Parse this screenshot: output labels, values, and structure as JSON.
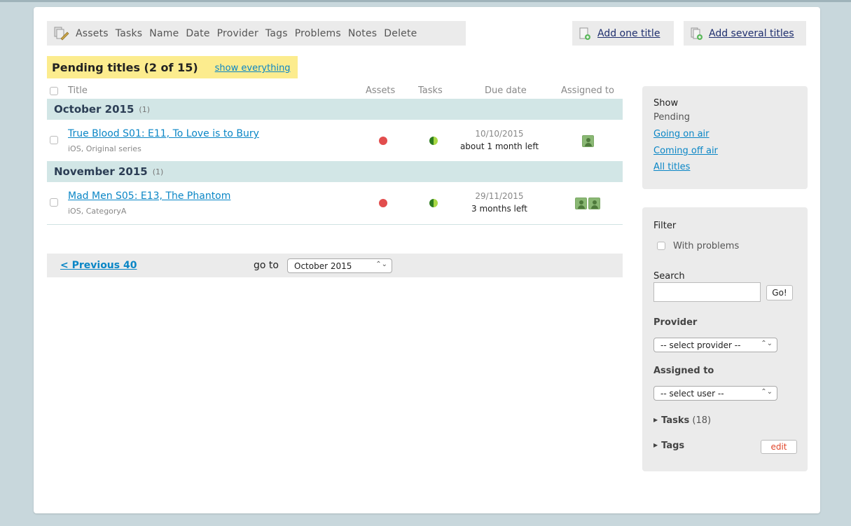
{
  "toolbar": {
    "items": [
      "Assets",
      "Tasks",
      "Name",
      "Date",
      "Provider",
      "Tags",
      "Problems",
      "Notes",
      "Delete"
    ],
    "add_one": "Add one title",
    "add_several": "Add several titles"
  },
  "heading": {
    "title": "Pending titles (2 of 15)",
    "show_everything": "show everything"
  },
  "table": {
    "columns": {
      "title": "Title",
      "assets": "Assets",
      "tasks": "Tasks",
      "due": "Due date",
      "assigned": "Assigned to"
    },
    "groups": [
      {
        "month": "October 2015",
        "count": "(1)",
        "rows": [
          {
            "title": "True Blood S01: E11, To Love is to Bury",
            "sub": "iOS, Original series",
            "assets_status": "red",
            "tasks_status": "half",
            "date": "10/10/2015",
            "left": "about 1 month left",
            "assignees": 1
          }
        ]
      },
      {
        "month": "November 2015",
        "count": "(1)",
        "rows": [
          {
            "title": "Mad Men S05: E13, The Phantom",
            "sub": "iOS, CategoryA",
            "assets_status": "red",
            "tasks_status": "half",
            "date": "29/11/2015",
            "left": "3 months left",
            "assignees": 2
          }
        ]
      }
    ]
  },
  "pager": {
    "previous": "< Previous 40",
    "goto_label": "go to",
    "goto_value": "October 2015"
  },
  "show_panel": {
    "heading": "Show",
    "current": "Pending",
    "links": [
      "Going on air",
      "Coming off air",
      "All titles"
    ]
  },
  "filter_panel": {
    "heading": "Filter",
    "with_problems": "With problems",
    "search_label": "Search",
    "search_value": "",
    "go": "Go!",
    "provider_label": "Provider",
    "provider_value": "-- select provider --",
    "assigned_label": "Assigned to",
    "assigned_value": "-- select user --",
    "tasks_label": "Tasks",
    "tasks_count": "(18)",
    "tags_label": "Tags",
    "edit": "edit"
  },
  "colors": {
    "background": "#c8d7dc",
    "highlight": "#fcec8e",
    "month_band": "#d2e6e6",
    "link": "#0a86c6",
    "status_red": "#e24d4d",
    "status_green": "#a8d845"
  }
}
